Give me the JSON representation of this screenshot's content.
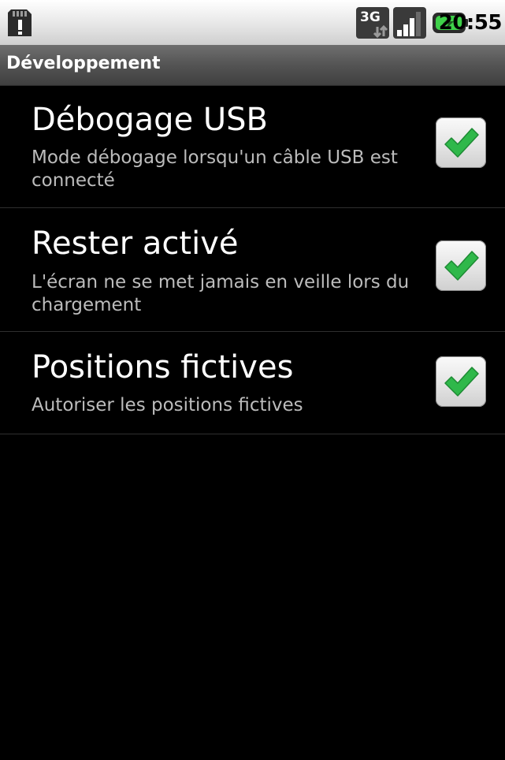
{
  "status_bar": {
    "time": "20:55",
    "icons": [
      "sd-card-warning-icon",
      "3g-data-icon",
      "signal-strength-icon",
      "battery-charging-icon"
    ],
    "network_label": "3G"
  },
  "title_bar": {
    "title": "Développement"
  },
  "preferences": [
    {
      "title": "Débogage USB",
      "summary": "Mode débogage lorsqu'un câble USB est connecté",
      "checked": true
    },
    {
      "title": "Rester activé",
      "summary": "L'écran ne se met jamais en veille lors du chargement",
      "checked": true
    },
    {
      "title": "Positions fictives",
      "summary": "Autoriser les positions fictives",
      "checked": true
    }
  ],
  "colors": {
    "background": "#000000",
    "title_text": "#ffffff",
    "summary_text": "#bcbcbc",
    "check_green": "#2fb84a",
    "status_bar": "#e6e6e6",
    "title_bar": "#545454"
  }
}
